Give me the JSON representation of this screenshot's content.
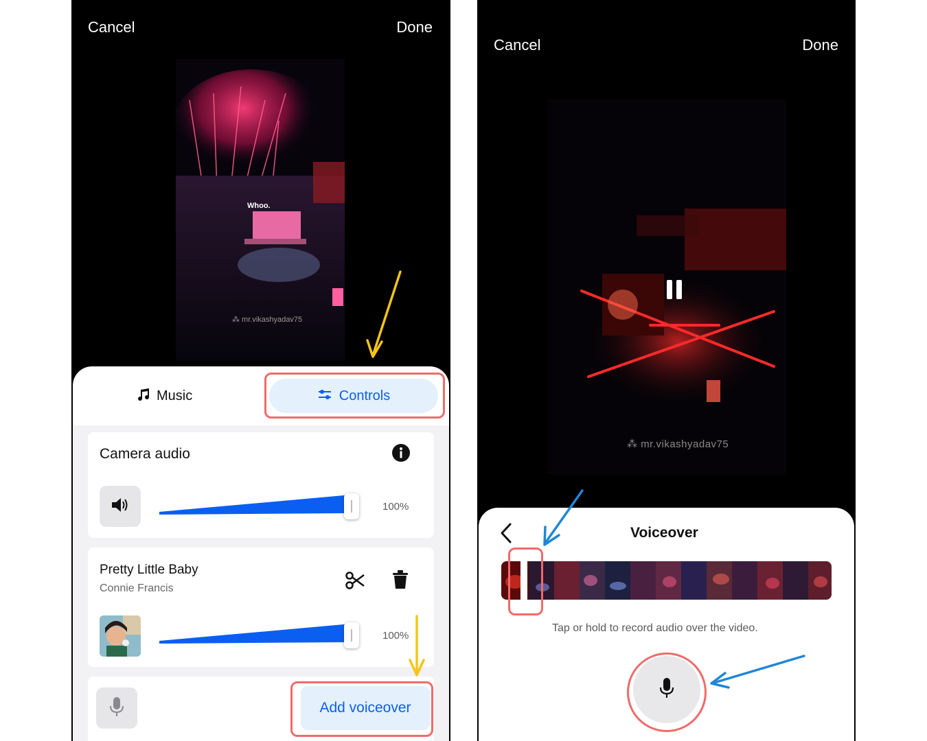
{
  "left": {
    "cancel_label": "Cancel",
    "done_label": "Done",
    "video_caption": "Whoo.",
    "watermark": "⁂ mr.vikashyadav75",
    "tabs": {
      "music_label": "Music",
      "controls_label": "Controls",
      "active": "controls"
    },
    "camera_audio": {
      "title": "Camera audio",
      "volume_percent": 100,
      "volume_label": "100%"
    },
    "track": {
      "title": "Pretty Little Baby",
      "artist": "Connie Francis",
      "volume_percent": 100,
      "volume_label": "100%"
    },
    "add_voiceover_label": "Add voiceover"
  },
  "right": {
    "cancel_label": "Cancel",
    "done_label": "Done",
    "watermark": "⁂ mr.vikashyadav75",
    "sheet_title": "Voiceover",
    "hint_text": "Tap or hold to record audio over the video.",
    "playback_state": "playing"
  },
  "colors": {
    "accent_blue": "#0a5ff0",
    "tab_active_bg": "#e4f0fb",
    "highlight_red": "#f06a6a",
    "arrow_yellow": "#f5c518",
    "arrow_blue": "#1f86d8"
  },
  "icons": [
    "music-note-icon",
    "controls-sliders-icon",
    "info-icon",
    "speaker-icon",
    "scissors-icon",
    "trash-icon",
    "microphone-icon",
    "back-chevron-icon",
    "pause-icon"
  ]
}
